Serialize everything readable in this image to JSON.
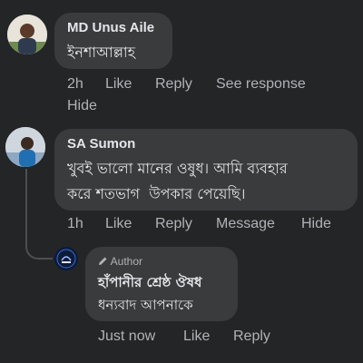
{
  "comments": [
    {
      "author": "MD Unus Aile",
      "text": "ইনশাআল্লাহ",
      "actions": {
        "time": "2h",
        "like": "Like",
        "reply": "Reply",
        "see_response": "See response",
        "hide": "Hide"
      }
    },
    {
      "author": "SA Sumon",
      "text_line1": "খুবই ভালো মানের ওষুধ। আমি ব্যবহার",
      "text_line2": "করে শতভাগ  উপকার পেয়েছি।",
      "actions": {
        "time": "1h",
        "like": "Like",
        "reply": "Reply",
        "message": "Message",
        "hide": "Hide"
      }
    }
  ],
  "reply": {
    "badge": "Author",
    "author": "হাঁপানীর শ্রেষ্ঠ ঔষধ",
    "text": "ধন্যবাদ আপনাকে",
    "actions": {
      "time": "Just now",
      "like": "Like",
      "reply": "Reply"
    }
  },
  "colors": {
    "background": "#242526",
    "bubble": "#3a3b3c",
    "text": "#e4e6eb",
    "muted": "#b0b3b8"
  }
}
